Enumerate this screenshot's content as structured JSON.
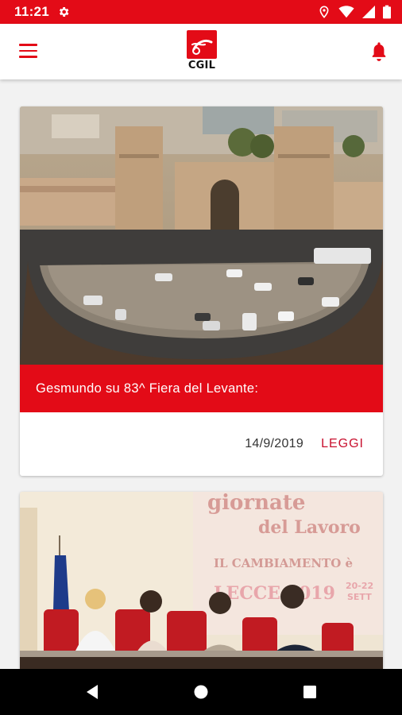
{
  "status_bar": {
    "time": "11:21",
    "icons": [
      "settings-gear-icon",
      "location-icon",
      "wifi-icon",
      "signal-icon",
      "battery-icon"
    ]
  },
  "app_bar": {
    "logo_text": "CGIL",
    "menu_icon": "hamburger-menu-icon",
    "notification_icon": "bell-icon"
  },
  "colors": {
    "brand_red": "#e30b17",
    "link_red": "#c8102e"
  },
  "articles": [
    {
      "title": "Gesmundo su 83^ Fiera del Levante:",
      "date": "14/9/2019",
      "link_label": "LEGGI",
      "image": "aerial-fiera-del-levante-entrance"
    },
    {
      "title": "",
      "image": "panel-conference-giornate-del-lavoro",
      "banner_lines": [
        "giornate",
        "del Lavoro",
        "IL CAMBIAMENTO è",
        "LECCE 2019",
        "20-22",
        "SETT"
      ]
    }
  ],
  "nav_bar": {
    "buttons": [
      "back-icon",
      "home-icon",
      "recents-icon"
    ]
  }
}
